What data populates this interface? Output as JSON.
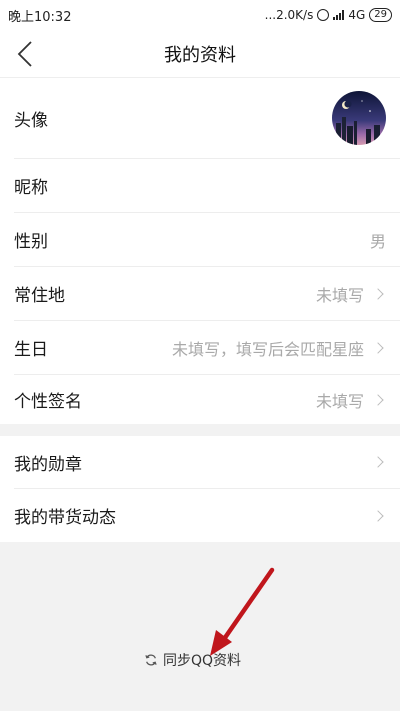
{
  "status_bar": {
    "time": "晚上10:32",
    "network_speed": "...2.0K/s",
    "network_type": "4G",
    "battery": "29"
  },
  "nav": {
    "title": "我的资料"
  },
  "profile": {
    "avatar_label": "头像",
    "nickname_label": "昵称",
    "gender_label": "性别",
    "gender_value": "男",
    "residence_label": "常住地",
    "residence_value": "未填写",
    "birthday_label": "生日",
    "birthday_value": "未填写，填写后会匹配星座",
    "signature_label": "个性签名",
    "signature_value": "未填写"
  },
  "more": {
    "medals_label": "我的勋章",
    "activity_label": "我的带货动态"
  },
  "sync": {
    "label": "同步QQ资料"
  },
  "colors": {
    "annotation_arrow": "#c0161c"
  }
}
